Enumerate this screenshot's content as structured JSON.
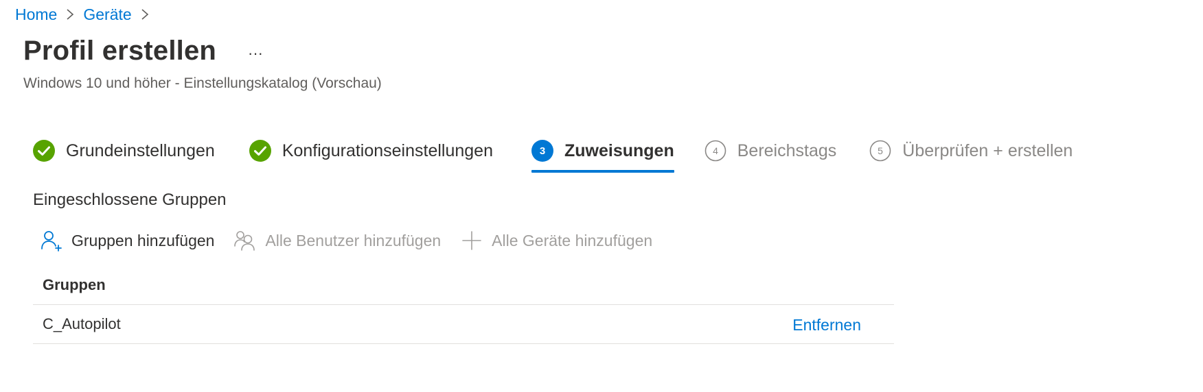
{
  "breadcrumb": {
    "items": [
      {
        "label": "Home"
      },
      {
        "label": "Geräte"
      }
    ]
  },
  "header": {
    "title": "Profil erstellen",
    "more_label": "···",
    "subtitle": "Windows 10 und höher - Einstellungskatalog (Vorschau)"
  },
  "wizard": {
    "steps": [
      {
        "number": "1",
        "label": "Grundeinstellungen",
        "state": "completed"
      },
      {
        "number": "2",
        "label": "Konfigurationseinstellungen",
        "state": "completed"
      },
      {
        "number": "3",
        "label": "Zuweisungen",
        "state": "active"
      },
      {
        "number": "4",
        "label": "Bereichstags",
        "state": "upcoming"
      },
      {
        "number": "5",
        "label": "Überprüfen + erstellen",
        "state": "upcoming"
      }
    ]
  },
  "included_groups": {
    "heading": "Eingeschlossene Gruppen",
    "commands": [
      {
        "label": "Gruppen hinzufügen",
        "icon": "add-person-icon",
        "enabled": true
      },
      {
        "label": "Alle Benutzer hinzufügen",
        "icon": "people-icon",
        "enabled": false
      },
      {
        "label": "Alle Geräte hinzufügen",
        "icon": "plus-icon",
        "enabled": false
      }
    ],
    "table": {
      "header": "Gruppen",
      "rows": [
        {
          "name": "C_Autopilot",
          "action": "Entfernen"
        }
      ]
    }
  },
  "colors": {
    "accent": "#0078d4",
    "success": "#57a300",
    "text": "#323130",
    "text_secondary": "#605e5c",
    "text_disabled": "#a19f9d",
    "divider": "#e1dfdd"
  }
}
